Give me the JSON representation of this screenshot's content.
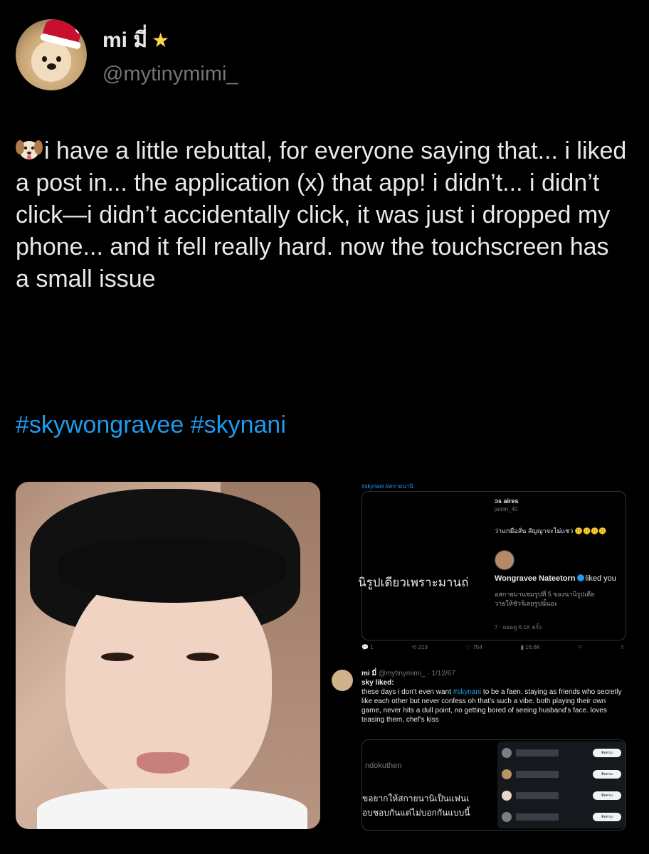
{
  "tweet": {
    "display_name": "mi มี่",
    "handle": "@mytinymimi_",
    "text": "i have a little rebuttal, for everyone saying that... i liked a post in... the application (x) that app! i didn’t... i didn’t click—i didn’t accidentally click, it was just i dropped my phone... and it fell really hard. now the touchscreen has a small issue",
    "hashtags": [
      "#skywongravee",
      "#skynani"
    ]
  },
  "screenshot": {
    "top_tags": "#skynani #สกายนานิ",
    "quote_name": "ɔs aires",
    "quote_handle": "jamin_40",
    "quote_line": "ว่าแกมือสั่น สัญญาจะไม่แชว 🤫🤫🤫🤫",
    "big_thai": "นิรูปเดียวเพราะมานถ่",
    "liked_name": "Wongravee Nateetorn",
    "liked_suffix": "liked you",
    "small_thai_1": "อสกายมานชมรูปที่ 5 ของนานิรูปเดีย",
    "small_thai_2": "วายให้ชัวร์เลยรูปนั้นอะ",
    "views_line": "7 · ยอดดู 6.1K ครั้ง",
    "actions": [
      "1",
      "213",
      "754",
      "16.6K"
    ],
    "reply_name": "mi มี่",
    "reply_handle": "@mytinymimi_ · 1/12/67",
    "reply_line1": "sky liked:",
    "reply_text_pre": "these days i don't even want ",
    "reply_tag": "#skynani",
    "reply_text_post": " to be a faen. staying as friends who secretly like each other but never confess oh that's such a vibe. both playing their own game, never hits a dull point, no getting bored of seeing husband's face. loves teasing them, chef's kiss",
    "inner_name": "ndokuthen",
    "inner_thai_1": "ขอยากให้สกายนานิเป็นแฟนเ",
    "inner_thai_2": "อบชอบกันแต่ไม่บอกกันแบบนี้",
    "follow_label": "ติดตาม"
  }
}
